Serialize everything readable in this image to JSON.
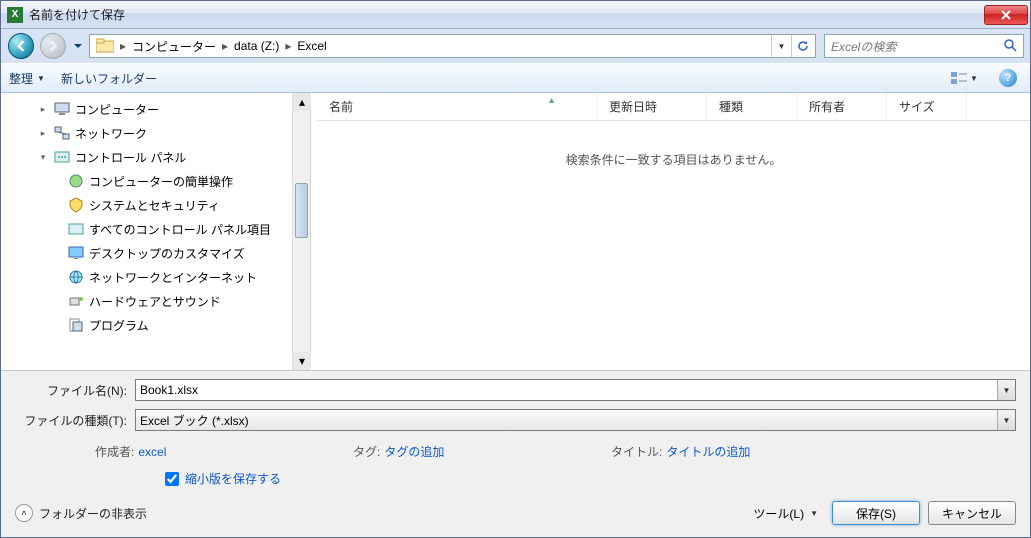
{
  "title": "名前を付けて保存",
  "breadcrumb": [
    "コンピューター",
    "data (Z:)",
    "Excel"
  ],
  "search_placeholder": "Excelの検索",
  "toolbar": {
    "organize": "整理",
    "new_folder": "新しいフォルダー"
  },
  "tree": [
    {
      "label": "コンピューター",
      "icon": "computer",
      "level": 1
    },
    {
      "label": "ネットワーク",
      "icon": "network",
      "level": 1
    },
    {
      "label": "コントロール パネル",
      "icon": "control-panel",
      "level": 1,
      "expanded": true
    },
    {
      "label": "コンピューターの簡単操作",
      "icon": "ease",
      "level": 2
    },
    {
      "label": "システムとセキュリティ",
      "icon": "security",
      "level": 2
    },
    {
      "label": "すべてのコントロール パネル項目",
      "icon": "all-cp",
      "level": 2
    },
    {
      "label": "デスクトップのカスタマイズ",
      "icon": "desktop",
      "level": 2
    },
    {
      "label": "ネットワークとインターネット",
      "icon": "net",
      "level": 2
    },
    {
      "label": "ハードウェアとサウンド",
      "icon": "hardware",
      "level": 2
    },
    {
      "label": "プログラム",
      "icon": "programs",
      "level": 2
    }
  ],
  "columns": {
    "name": "名前",
    "date": "更新日時",
    "type": "種類",
    "owner": "所有者",
    "size": "サイズ"
  },
  "empty_message": "検索条件に一致する項目はありません。",
  "filename_label": "ファイル名(N):",
  "filename_value": "Book1.xlsx",
  "filetype_label": "ファイルの種類(T):",
  "filetype_value": "Excel ブック (*.xlsx)",
  "meta": {
    "author_label": "作成者:",
    "author_value": "excel",
    "tag_label": "タグ:",
    "tag_value": "タグの追加",
    "title_label": "タイトル:",
    "title_value": "タイトルの追加"
  },
  "thumbnail_label": "縮小版を保存する",
  "footer": {
    "hide_folders": "フォルダーの非表示",
    "tools": "ツール(L)",
    "save": "保存(S)",
    "cancel": "キャンセル"
  }
}
